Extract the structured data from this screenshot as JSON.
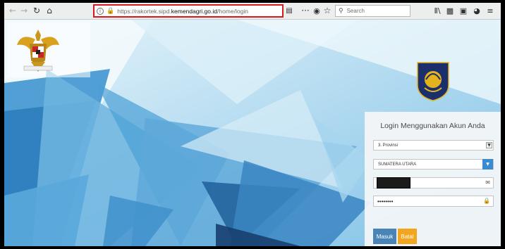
{
  "browser": {
    "url_prefix": "https://rakortek.sipd.",
    "url_domain": "kemendagri.go.id",
    "url_path": "/home/login",
    "search_placeholder": "Search",
    "info_glyph": "i",
    "icons": [
      "back-icon",
      "forward-icon",
      "reload-icon",
      "home-icon",
      "info-icon",
      "lock-icon",
      "reader-view-icon",
      "more-icon",
      "pocket-icon",
      "bookmark-star-icon",
      "search-icon",
      "library-icon",
      "sidebar-icon",
      "screenshot-icon",
      "extension-icon",
      "menu-icon"
    ]
  },
  "login": {
    "title": "Login Menggunakan Akun Anda",
    "level_select_value": "3. Provinsi",
    "region_select_value": "SUMATERA UTARA",
    "password_value": "••••••••",
    "submit_label": "Masuk",
    "cancel_label": "Batal",
    "colors": {
      "submit": "#4a84b7",
      "cancel": "#f2a51f",
      "region_caret": "#3a8bd0"
    }
  },
  "page": {
    "left_emblem": "garuda-pancasila-emblem",
    "right_logo": "kemendagri-logo"
  }
}
